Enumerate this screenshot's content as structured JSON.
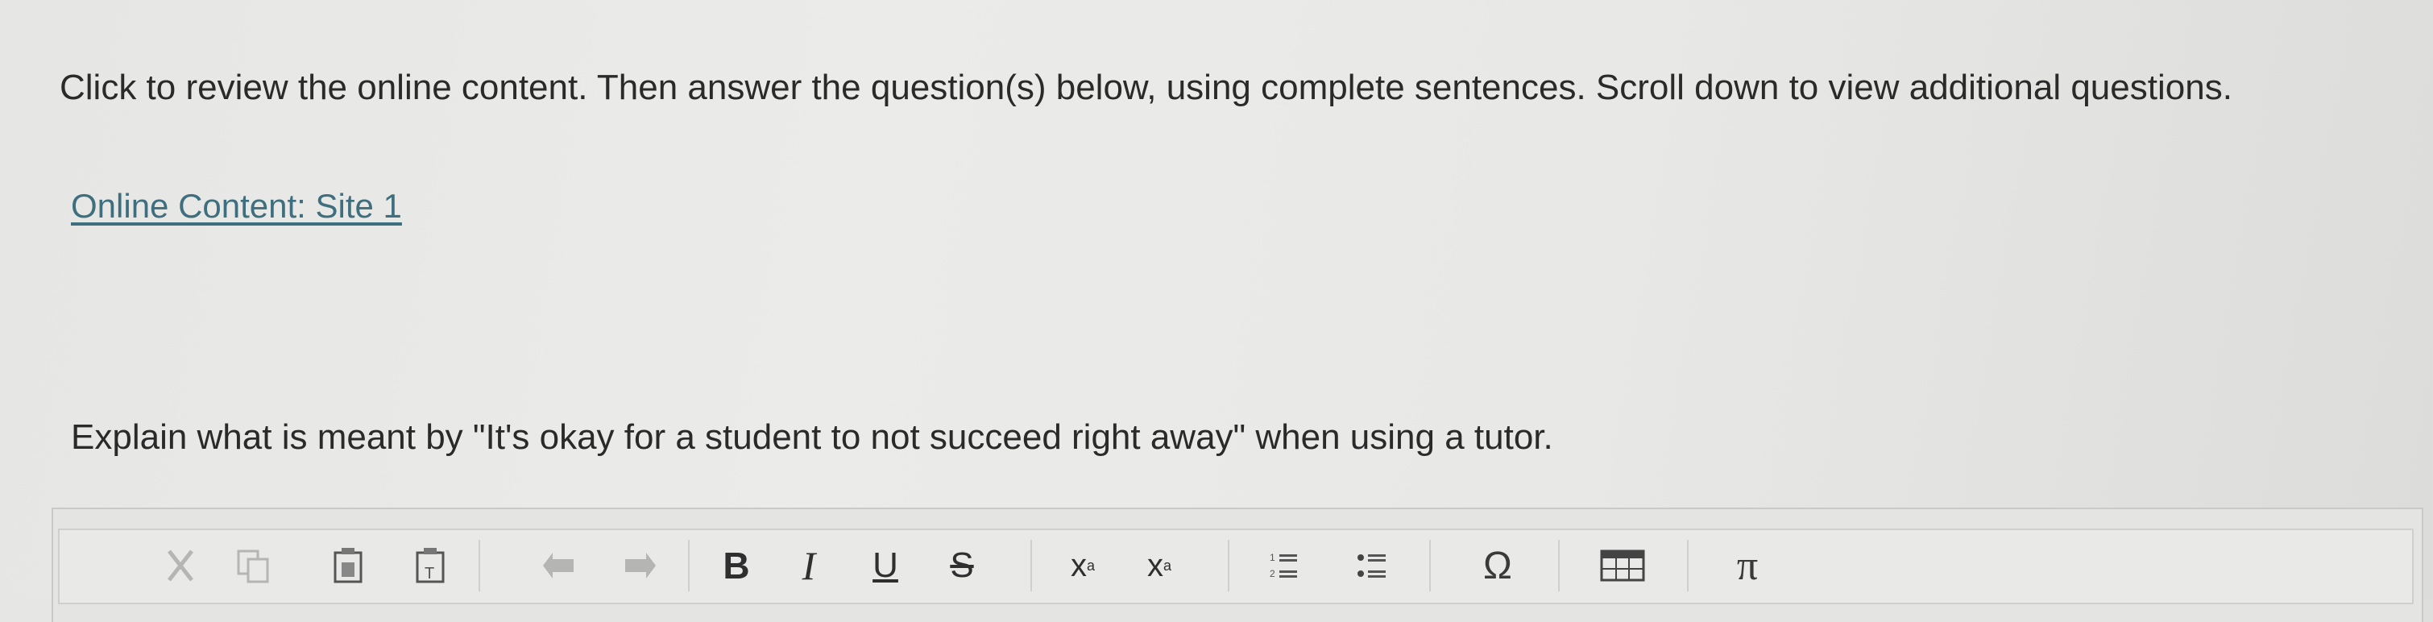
{
  "instructions": "Click to review the online content. Then answer the question(s) below, using complete sentences. Scroll down to view additional questions.",
  "online_content_link": "Online Content: Site 1",
  "question": "Explain what is meant by \"It's okay for a student to not succeed right away\" when using a tutor.",
  "toolbar": {
    "bold": "B",
    "italic": "I",
    "underline": "U",
    "strike": "S",
    "subscript_base": "x",
    "subscript_mark": "a",
    "superscript_base": "x",
    "superscript_mark": "a",
    "omega": "Ω",
    "pi": "π",
    "icons": [
      "cut-icon",
      "copy-icon",
      "paste-icon",
      "paste-text-icon",
      "undo-icon",
      "redo-icon",
      "numbered-list-icon",
      "bulleted-list-icon",
      "table-icon"
    ]
  },
  "colors": {
    "link": "#3f6f7e",
    "text": "#2a2a2a",
    "background": "#e8e8e6"
  }
}
